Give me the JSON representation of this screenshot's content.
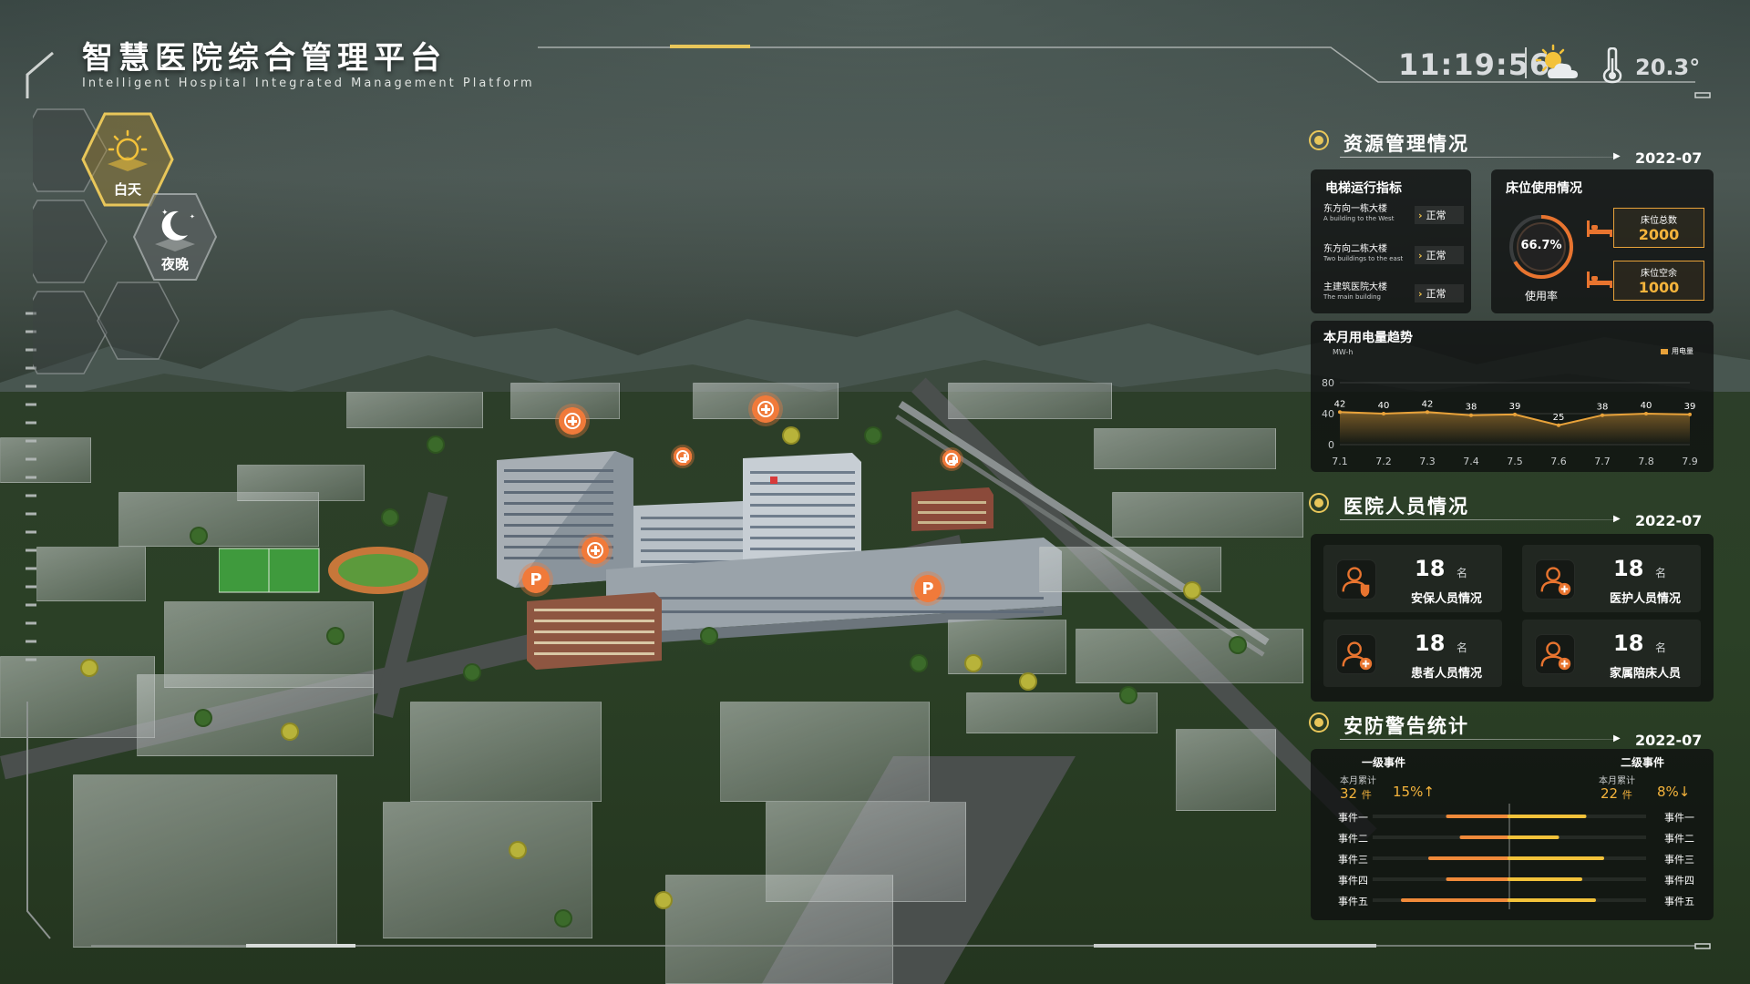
{
  "header": {
    "title": "智慧医院综合管理平台",
    "subtitle": "Intelligent Hospital Integrated Management Platform",
    "time": "11:19:56",
    "temperature": "20.3°",
    "weather_icon": "partly-cloudy-sun-icon",
    "thermometer_icon": "thermometer-icon"
  },
  "mode_switch": {
    "day_label": "白天",
    "night_label": "夜晚",
    "active": "day"
  },
  "resource": {
    "title": "资源管理情况",
    "date": "2022-07",
    "elevator": {
      "title": "电梯运行指标",
      "rows": [
        {
          "name": "东方向一栋大楼",
          "en": "A building to the West",
          "status": "正常"
        },
        {
          "name": "东方向二栋大楼",
          "en": "Two buildings to the east",
          "status": "正常"
        },
        {
          "name": "主建筑医院大楼",
          "en": "The main building",
          "status": "正常"
        }
      ]
    },
    "bed": {
      "title": "床位使用情况",
      "usage_rate": "66.7%",
      "usage_value": 0.667,
      "usage_label": "使用率",
      "total_label": "床位总数",
      "total_value": "2000",
      "free_label": "床位空余",
      "free_value": "1000"
    }
  },
  "power": {
    "title": "本月用电量趋势",
    "unit": "MW-h",
    "legend": "用电量"
  },
  "chart_data": {
    "type": "line",
    "title": "本月用电量趋势",
    "ylabel": "MW-h",
    "x": [
      "7.1",
      "7.2",
      "7.3",
      "7.4",
      "7.5",
      "7.6",
      "7.7",
      "7.8",
      "7.9"
    ],
    "series": [
      {
        "name": "用电量",
        "values": [
          42,
          40,
          42,
          38,
          39,
          25,
          38,
          40,
          39
        ]
      }
    ],
    "yticks": [
      "0",
      "40",
      "80"
    ],
    "ylim": [
      0,
      80
    ],
    "color": "#e8a23a"
  },
  "staff": {
    "title": "医院人员情况",
    "date": "2022-07",
    "cards": [
      {
        "count": "18",
        "unit": "名",
        "label": "安保人员情况",
        "icon": "security-staff-icon"
      },
      {
        "count": "18",
        "unit": "名",
        "label": "医护人员情况",
        "icon": "medical-staff-icon"
      },
      {
        "count": "18",
        "unit": "名",
        "label": "患者人员情况",
        "icon": "patient-icon"
      },
      {
        "count": "18",
        "unit": "名",
        "label": "家属陪床人员",
        "icon": "family-escort-icon"
      }
    ]
  },
  "security": {
    "title": "安防警告统计",
    "date": "2022-07",
    "level1": {
      "title": "一级事件",
      "sub": "本月累计",
      "count": "32",
      "unit": "件",
      "pct": "15%↑"
    },
    "level2": {
      "title": "二级事件",
      "sub": "本月累计",
      "count": "22",
      "unit": "件",
      "pct": "8%↓"
    },
    "events": [
      "事件一",
      "事件二",
      "事件三",
      "事件四",
      "事件五"
    ],
    "level1_bars": [
      [
        0.55,
        1.0
      ],
      [
        0.65,
        1.0
      ],
      [
        0.42,
        1.0
      ],
      [
        0.55,
        1.0
      ],
      [
        0.22,
        1.0
      ]
    ],
    "level2_bars": [
      [
        0.0,
        0.55
      ],
      [
        0.0,
        0.35
      ],
      [
        0.0,
        0.68
      ],
      [
        0.0,
        0.52
      ],
      [
        0.0,
        0.62
      ]
    ]
  },
  "colors": {
    "accent": "#e8c65a",
    "orange": "#e8a23a",
    "marker": "#f07a3a",
    "panel_bg": "#0e1010"
  }
}
